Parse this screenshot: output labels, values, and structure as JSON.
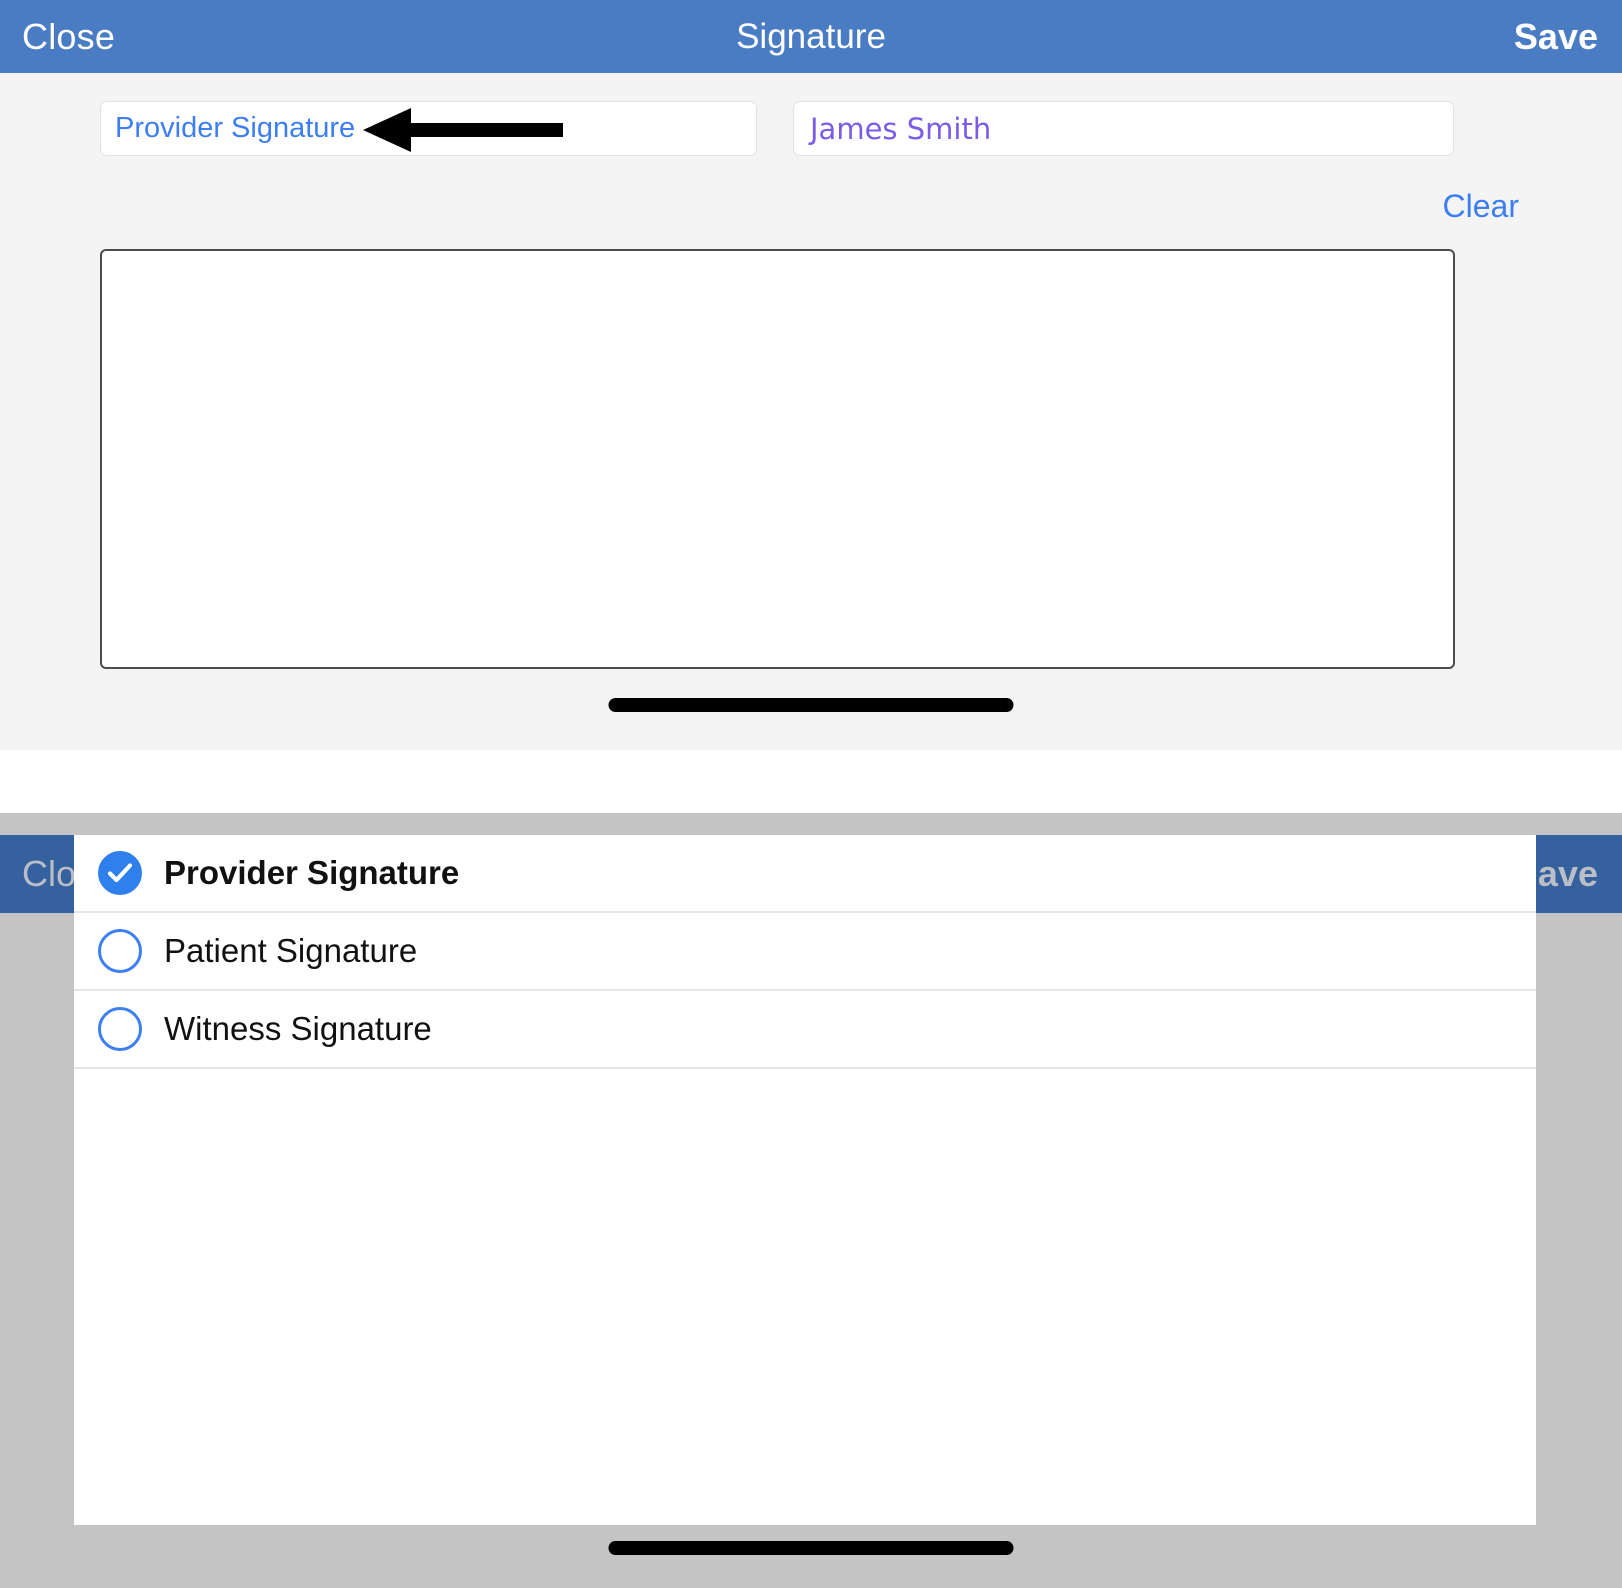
{
  "screen1": {
    "navbar": {
      "close_label": "Close",
      "title": "Signature",
      "save_label": "Save",
      "background_color": "#4a7cc3",
      "text_color": "#ffffff"
    },
    "fields": [
      {
        "name": "signature-type-field",
        "value": "Provider Signature",
        "value_color": "#3d7ff2"
      },
      {
        "name": "signer-name-field",
        "value": "James Smith",
        "value_color": "#7b5ce8"
      }
    ],
    "clear_label": "Clear",
    "clear_color": "#3d7ff2",
    "signature_canvas": {
      "content": "",
      "border_color": "#4c4c4c",
      "background_color": "#ffffff"
    },
    "annotation": {
      "type": "arrow-left",
      "color": "#000000",
      "points_to": "signature-type-field"
    }
  },
  "screen2": {
    "navbar": {
      "close_label": "Clos",
      "save_label": "ave",
      "background_color": "#35619e",
      "text_color": "#b9bec7"
    },
    "overlay_color": "#c4c4c4",
    "dropdown": {
      "options": [
        {
          "label": "Provider Signature",
          "selected": true
        },
        {
          "label": "Patient Signature",
          "selected": false
        },
        {
          "label": "Witness Signature",
          "selected": false
        }
      ],
      "selected_color": "#2f80ed",
      "unselected_border_color": "#3d7ff2",
      "background_color": "#ffffff"
    }
  }
}
